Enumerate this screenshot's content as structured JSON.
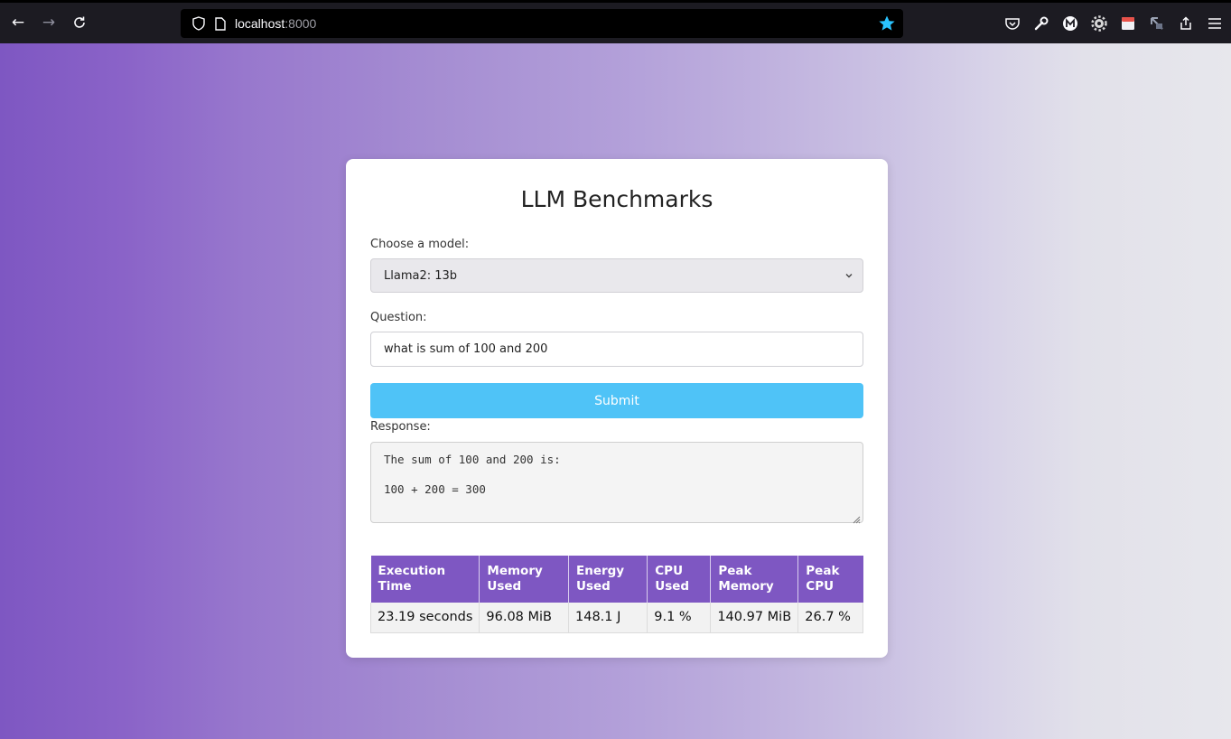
{
  "browser": {
    "url_host": "localhost",
    "url_port": ":8000"
  },
  "page": {
    "title": "LLM Benchmarks",
    "model_label": "Choose a model:",
    "model_selected": "Llama2: 13b",
    "question_label": "Question:",
    "question_value": "what is sum of 100 and 200",
    "submit_label": "Submit",
    "response_label": "Response:",
    "response_lines": [
      "The sum of 100 and 200 is:",
      "100 + 200 = 300"
    ]
  },
  "metrics": {
    "headers": [
      [
        "Execution",
        "Time"
      ],
      [
        "Memory",
        "Used"
      ],
      [
        "Energy",
        "Used"
      ],
      [
        "CPU",
        "Used"
      ],
      [
        "Peak",
        "Memory"
      ],
      [
        "Peak",
        "CPU"
      ]
    ],
    "values": [
      "23.19 seconds",
      "96.08 MiB",
      "148.1 J",
      "9.1 %",
      "140.97 MiB",
      "26.7 %"
    ]
  },
  "colors": {
    "accent_purple": "#7e57c2",
    "submit_blue": "#4fc3f7",
    "bookmark_star": "#2ac3ff"
  }
}
